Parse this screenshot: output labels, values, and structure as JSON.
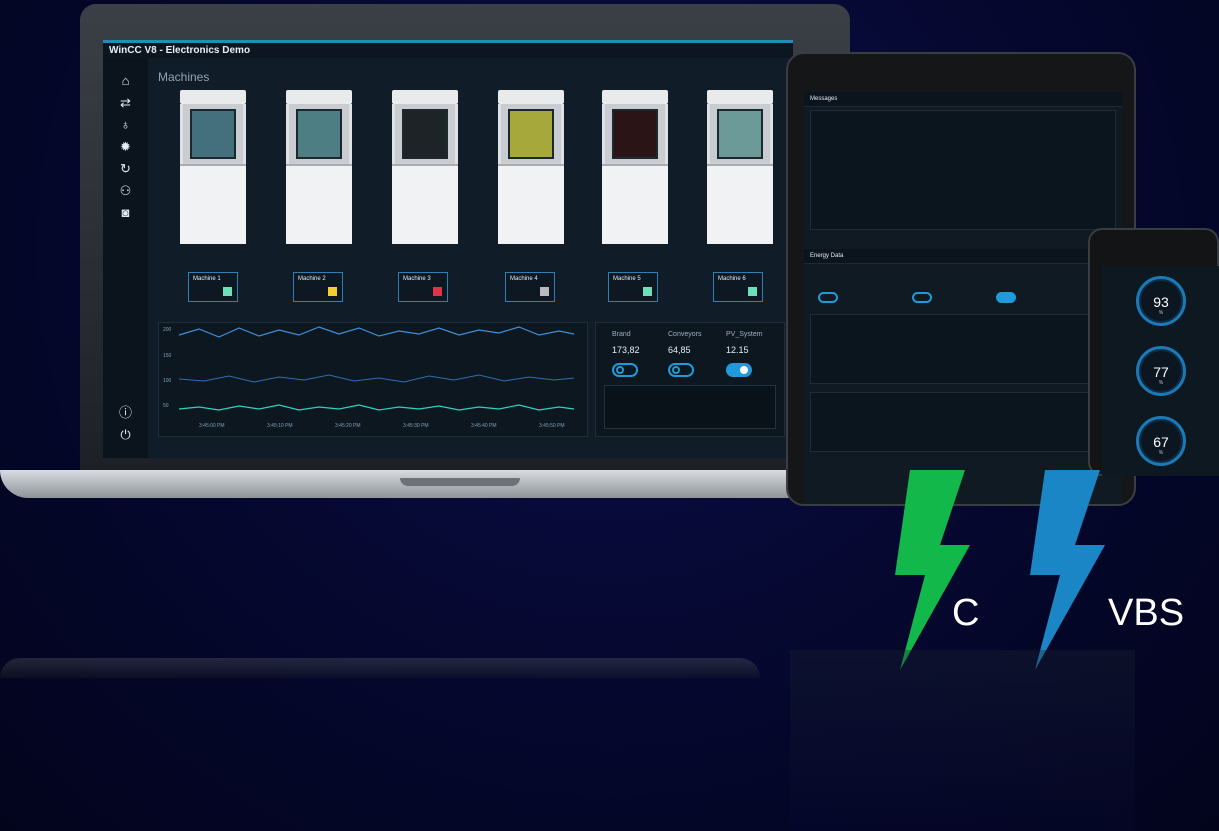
{
  "app": {
    "title": "WinCC V8 - Electronics Demo",
    "page_title": "Machines"
  },
  "nav": {
    "icons": [
      "home-icon",
      "transfer-icon",
      "stethoscope-icon",
      "gear-icon",
      "refresh-icon",
      "gamepad-icon",
      "camera-icon"
    ],
    "bottom_icons": [
      "info-icon",
      "power-icon"
    ]
  },
  "machines": [
    {
      "label": "Machine 1",
      "status_color": "#6ee0b8",
      "glass": "#43707c"
    },
    {
      "label": "Machine 2",
      "status_color": "#f2cf2e",
      "glass": "#4c7e83"
    },
    {
      "label": "Machine 3",
      "status_color": "#e2334b",
      "glass": "#1e2328"
    },
    {
      "label": "Machine 4",
      "status_color": "#b9bcbf",
      "glass": "#a6a83c"
    },
    {
      "label": "Machine 5",
      "status_color": "#6ee0b8",
      "glass": "#2a1416"
    },
    {
      "label": "Machine 6",
      "status_color": "#6ee0b8",
      "glass": "#6b9a98"
    }
  ],
  "kpis": [
    {
      "label": "Brand",
      "value": "173,82",
      "toggle": "off"
    },
    {
      "label": "Conveyors",
      "value": "64,85",
      "toggle": "off"
    },
    {
      "label": "PV_System",
      "value": "12.15",
      "toggle": "on"
    }
  ],
  "chart_ticks": {
    "y": [
      "200",
      "150",
      "100",
      "50"
    ],
    "x": [
      "3:45:00 PM",
      "3:45:10 PM",
      "3:45:20 PM",
      "3:45:30 PM",
      "3:45:40 PM",
      "3:45:50 PM"
    ]
  },
  "tablet": {
    "messages_title": "Messages",
    "energy_title": "Energy Data"
  },
  "phone": {
    "gauges": [
      {
        "value": "93",
        "unit": "%"
      },
      {
        "value": "77",
        "unit": "%"
      },
      {
        "value": "67",
        "unit": "%"
      }
    ]
  },
  "labels": {
    "c": "C",
    "vbs": "VBS"
  },
  "colors": {
    "c_bolt": "#12b84a",
    "vbs_bolt": "#1b86c6",
    "accent": "#1e9bd8"
  }
}
